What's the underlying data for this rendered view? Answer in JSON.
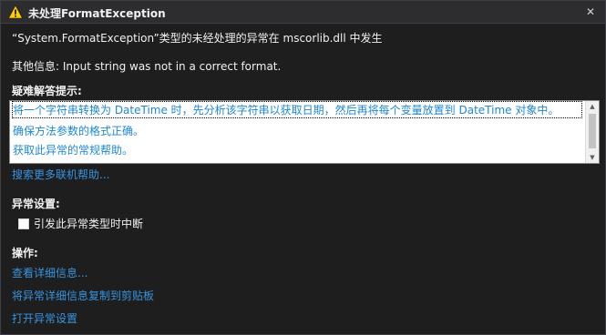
{
  "titlebar": {
    "title": "未处理FormatException",
    "close_glyph": "✕"
  },
  "main": {
    "message": "“System.FormatException”类型的未经处理的异常在 mscorlib.dll 中发生",
    "extra_info": "其他信息: Input string was not in a correct format."
  },
  "troubleshooting": {
    "heading": "疑难解答提示:",
    "tips": [
      "将一个字符串转换为 DateTime 时，先分析该字符串以获取日期，然后再将每个变量放置到 DateTime 对象中。",
      "确保方法参数的格式正确。",
      "获取此异常的常规帮助。"
    ],
    "more_help_link": "搜索更多联机帮助..."
  },
  "exception_settings": {
    "heading": "异常设置:",
    "break_checkbox_label": "引发此异常类型时中断",
    "break_checked": false
  },
  "actions": {
    "heading": "操作:",
    "links": [
      "查看详细信息...",
      "将异常详细信息复制到剪贴板",
      "打开异常设置"
    ]
  },
  "colors": {
    "background": "#1e1e1e",
    "link": "#3794e0",
    "tip_text": "#1e87d4",
    "warning": "#ffcc00"
  },
  "icons": {
    "title_icon": "warning-icon",
    "close": "close-icon",
    "scroll_up": "scroll-up-icon",
    "scroll_down": "scroll-down-icon"
  }
}
